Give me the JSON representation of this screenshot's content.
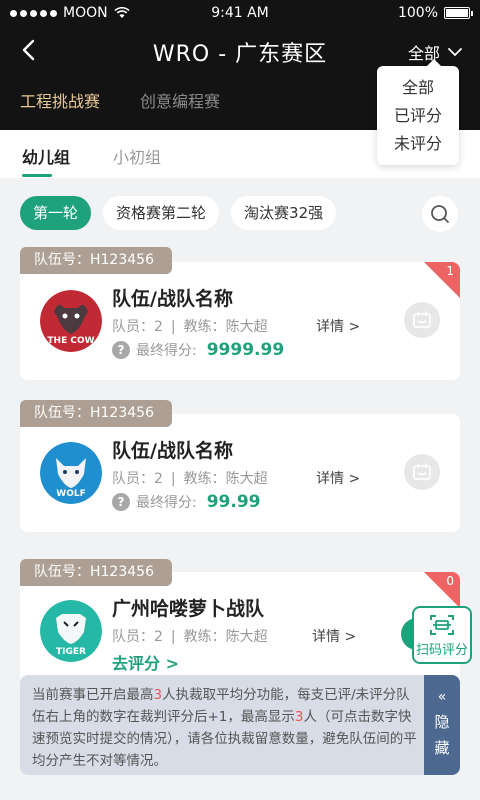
{
  "status_bar": {
    "carrier": "MOON",
    "time": "9:41 AM",
    "battery": "100%"
  },
  "nav": {
    "title": "WRO - 广东赛区",
    "filter_label": "全部"
  },
  "competition_tabs": [
    "工程挑战赛",
    "创意编程赛"
  ],
  "filter_menu": [
    "全部",
    "已评分",
    "未评分"
  ],
  "age_tabs": [
    "幼儿组",
    "小初组"
  ],
  "rounds": [
    "第一轮",
    "资格赛第二轮",
    "淘汰赛32强"
  ],
  "cards": [
    {
      "team_no": "队伍号：H123456",
      "name": "队伍/战队名称",
      "members": "队员：2",
      "coach": "教练：陈大超",
      "detail": "详情 >",
      "score_label": "最终得分:",
      "score": "9999.99",
      "badge": "1",
      "logo_text": "THE COW",
      "logo_color": "#c12a34"
    },
    {
      "team_no": "队伍号：H123456",
      "name": "队伍/战队名称",
      "members": "队员：2",
      "coach": "教练：陈大超",
      "detail": "详情 >",
      "score_label": "最终得分:",
      "score": "99.99",
      "logo_text": "WOLF",
      "logo_color": "#1f8fcf"
    },
    {
      "team_no": "队伍号：H123456",
      "name": "广州哈喽萝卜战队",
      "members": "队员：2",
      "coach": "教练：陈大超",
      "detail": "详情 >",
      "rate_link": "去评分 >",
      "badge": "0",
      "logo_text": "TIGER",
      "logo_color": "#26b8a6"
    }
  ],
  "scan_button": "扫码评分",
  "notice": {
    "p1": "当前赛事已开启最高",
    "n1": "3",
    "p2": "人执裁取平均分功能，每支已评/未评分队伍右上角的数字在裁判评分后+1，最高显示",
    "n2": "3",
    "p3": "人（可点击数字快速预览实时提交的情况），请各位执裁留意数量，避免队伍间的平均分产生不对等情况。",
    "hide_label": "隐藏"
  },
  "colors": {
    "accent": "#1ea27c",
    "badge": "#ee6464",
    "tag": "#ad9f93",
    "notice_btn": "#4e6990",
    "gold": "#e8c896"
  }
}
